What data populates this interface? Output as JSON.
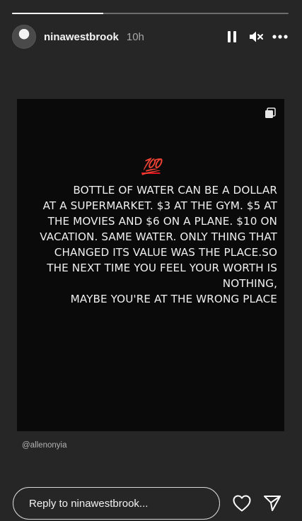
{
  "story": {
    "progress": 0.33,
    "username": "ninawestbrook",
    "time_ago": "10h",
    "controls": {
      "pause_icon": "pause-icon",
      "mute_icon": "muted-speaker-icon",
      "more_icon": "more-dots-icon"
    }
  },
  "post": {
    "emoji": "💯",
    "quote": "BOTTLE OF WATER CAN BE A DOLLAR\nAT A SUPERMARKET. $3 AT THE GYM. $5 AT\nTHE MOVIES AND $6 ON A PLANE. $10 ON\nVACATION. SAME WATER. ONLY THING THAT\nCHANGED ITS VALUE WAS THE PLACE.SO\nTHE NEXT TIME YOU FEEL YOUR WORTH IS\nNOTHING,\nMAYBE YOU'RE AT THE WRONG PLACE",
    "handle": "@allenonyia",
    "multi_icon": "multiple-images-icon"
  },
  "reply": {
    "placeholder": "Reply to ninawestbrook...",
    "like_icon": "heart-icon",
    "share_icon": "send-icon"
  },
  "colors": {
    "background": "#262626",
    "post_background": "#0a0a0a",
    "emoji_red": "#e0141f"
  }
}
